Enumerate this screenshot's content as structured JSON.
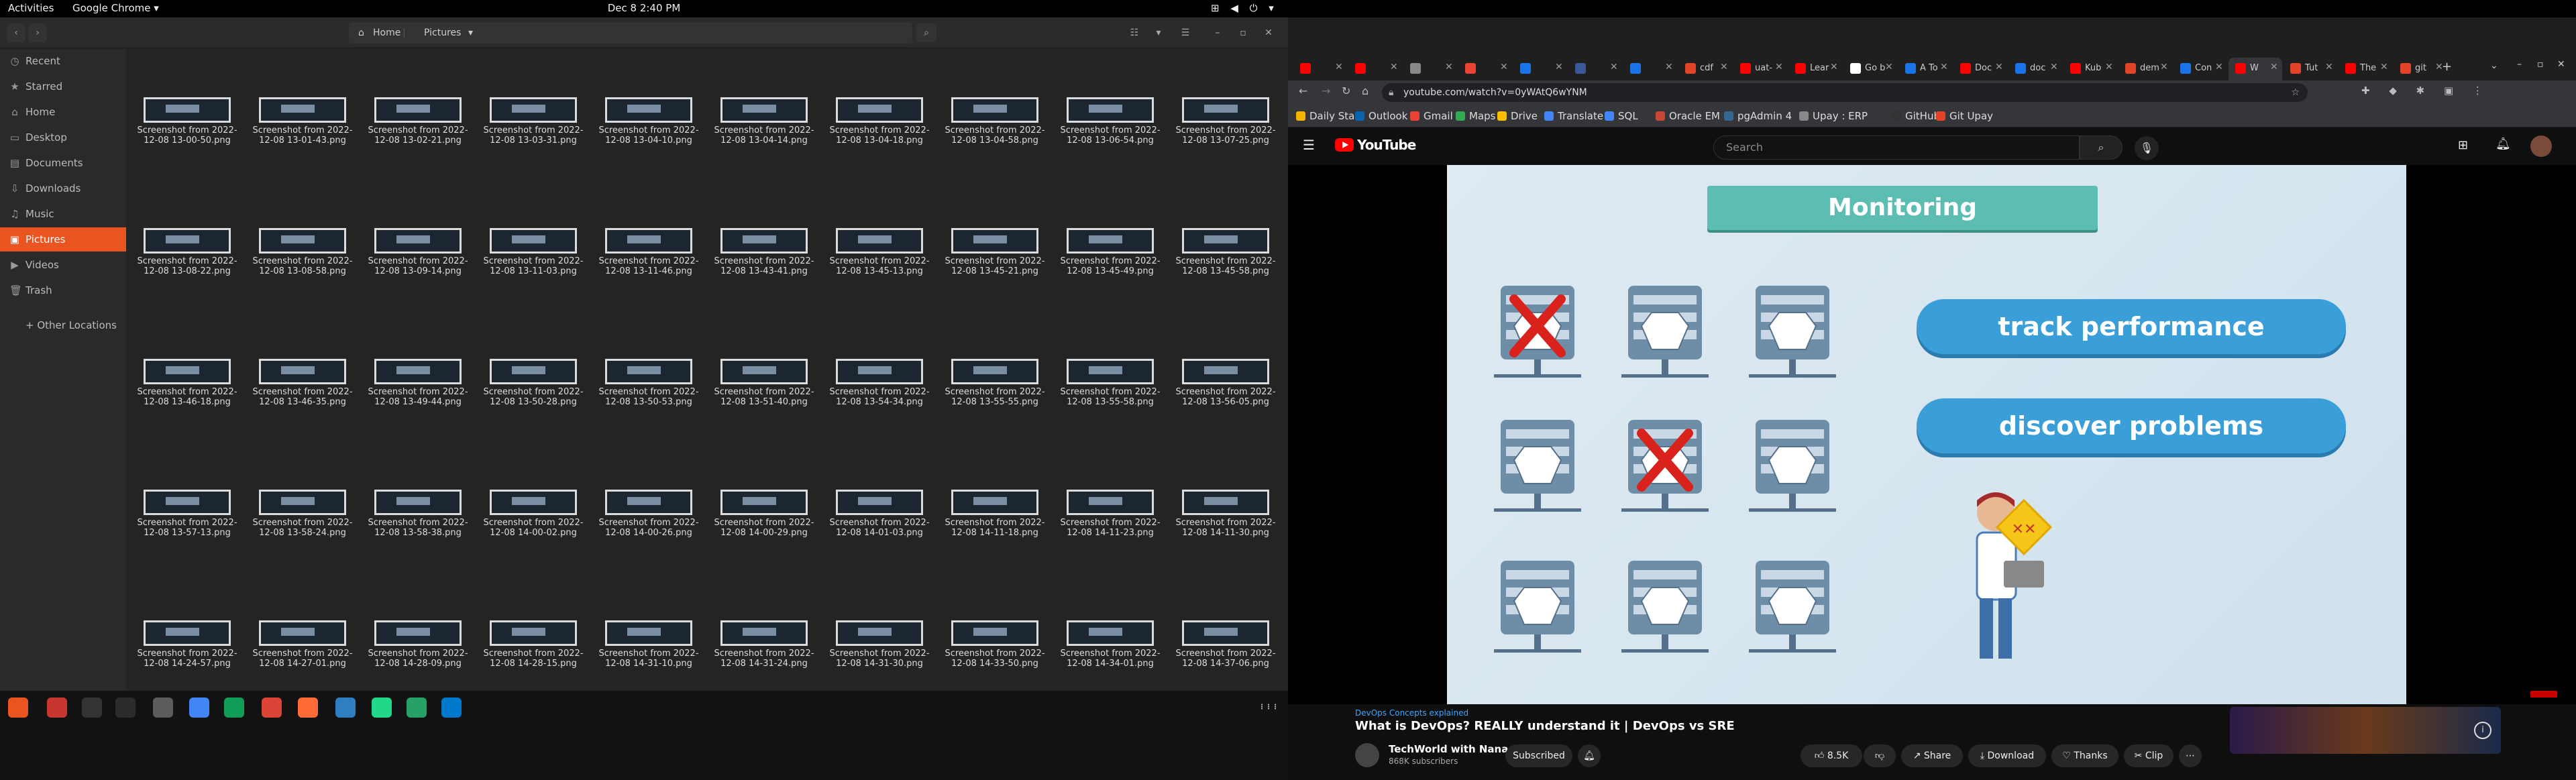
{
  "system": {
    "activities": "Activities",
    "app_menu": "Google Chrome ▾",
    "clock": "Dec 8  2:40 PM",
    "tray": "⊞ ◀ ⏻ ▾"
  },
  "files": {
    "path": {
      "home": "Home",
      "current": "Pictures"
    },
    "sidebar": [
      {
        "label": "Recent",
        "icon": "clock-icon",
        "glyph": "◷"
      },
      {
        "label": "Starred",
        "icon": "star-icon",
        "glyph": "★"
      },
      {
        "label": "Home",
        "icon": "home-icon",
        "glyph": "⌂"
      },
      {
        "label": "Desktop",
        "icon": "desktop-icon",
        "glyph": "▭"
      },
      {
        "label": "Documents",
        "icon": "document-icon",
        "glyph": "▤"
      },
      {
        "label": "Downloads",
        "icon": "download-icon",
        "glyph": "⇩"
      },
      {
        "label": "Music",
        "icon": "music-icon",
        "glyph": "♫"
      },
      {
        "label": "Pictures",
        "icon": "picture-icon",
        "glyph": "▣"
      },
      {
        "label": "Videos",
        "icon": "video-icon",
        "glyph": "▶"
      },
      {
        "label": "Trash",
        "icon": "trash-icon",
        "glyph": "🗑"
      },
      {
        "label": "+ Other Locations",
        "icon": "plus-icon",
        "glyph": ""
      }
    ],
    "active_item": "Pictures",
    "files": [
      "Screenshot from 2022-12-08 13-00-50.png",
      "Screenshot from 2022-12-08 13-01-43.png",
      "Screenshot from 2022-12-08 13-02-21.png",
      "Screenshot from 2022-12-08 13-03-31.png",
      "Screenshot from 2022-12-08 13-04-10.png",
      "Screenshot from 2022-12-08 13-04-14.png",
      "Screenshot from 2022-12-08 13-04-18.png",
      "Screenshot from 2022-12-08 13-04-58.png",
      "Screenshot from 2022-12-08 13-06-54.png",
      "Screenshot from 2022-12-08 13-07-25.png",
      "Screenshot from 2022-12-08 13-08-22.png",
      "Screenshot from 2022-12-08 13-08-58.png",
      "Screenshot from 2022-12-08 13-09-14.png",
      "Screenshot from 2022-12-08 13-11-03.png",
      "Screenshot from 2022-12-08 13-11-46.png",
      "Screenshot from 2022-12-08 13-43-41.png",
      "Screenshot from 2022-12-08 13-45-13.png",
      "Screenshot from 2022-12-08 13-45-21.png",
      "Screenshot from 2022-12-08 13-45-49.png",
      "Screenshot from 2022-12-08 13-45-58.png",
      "Screenshot from 2022-12-08 13-46-18.png",
      "Screenshot from 2022-12-08 13-46-35.png",
      "Screenshot from 2022-12-08 13-49-44.png",
      "Screenshot from 2022-12-08 13-50-28.png",
      "Screenshot from 2022-12-08 13-50-53.png",
      "Screenshot from 2022-12-08 13-51-40.png",
      "Screenshot from 2022-12-08 13-54-34.png",
      "Screenshot from 2022-12-08 13-55-55.png",
      "Screenshot from 2022-12-08 13-55-58.png",
      "Screenshot from 2022-12-08 13-56-05.png",
      "Screenshot from 2022-12-08 13-57-13.png",
      "Screenshot from 2022-12-08 13-58-24.png",
      "Screenshot from 2022-12-08 13-58-38.png",
      "Screenshot from 2022-12-08 14-00-02.png",
      "Screenshot from 2022-12-08 14-00-26.png",
      "Screenshot from 2022-12-08 14-00-29.png",
      "Screenshot from 2022-12-08 14-01-03.png",
      "Screenshot from 2022-12-08 14-11-18.png",
      "Screenshot from 2022-12-08 14-11-23.png",
      "Screenshot from 2022-12-08 14-11-30.png",
      "Screenshot from 2022-12-08 14-24-57.png",
      "Screenshot from 2022-12-08 14-27-01.png",
      "Screenshot from 2022-12-08 14-28-09.png",
      "Screenshot from 2022-12-08 14-28-15.png",
      "Screenshot from 2022-12-08 14-31-10.png",
      "Screenshot from 2022-12-08 14-31-24.png",
      "Screenshot from 2022-12-08 14-31-30.png",
      "Screenshot from 2022-12-08 14-33-50.png",
      "Screenshot from 2022-12-08 14-34-01.png",
      "Screenshot from 2022-12-08 14-37-06.png"
    ]
  },
  "dock": [
    {
      "name": "ubuntu-software-icon",
      "color": "#e95420"
    },
    {
      "name": "app-center-icon",
      "color": "#c7362f"
    },
    {
      "name": "obs-icon",
      "color": "#333333"
    },
    {
      "name": "terminal-icon",
      "color": "#2c2c2c"
    },
    {
      "name": "files-icon",
      "color": "#5c5c5c"
    },
    {
      "name": "docs-icon",
      "color": "#4285f4"
    },
    {
      "name": "sheets-icon",
      "color": "#0f9d58"
    },
    {
      "name": "chrome-icon",
      "color": "#db4437"
    },
    {
      "name": "postman-icon",
      "color": "#ff6c37"
    },
    {
      "name": "virtualbox-icon",
      "color": "#2d7fc1"
    },
    {
      "name": "pycharm-icon",
      "color": "#21d789"
    },
    {
      "name": "image-viewer-icon",
      "color": "#26a269"
    },
    {
      "name": "vscode-icon",
      "color": "#007acc"
    }
  ],
  "chrome": {
    "tabs": [
      {
        "title": "",
        "color": "#ff0000",
        "active": false
      },
      {
        "title": "",
        "color": "#ff0000",
        "active": false
      },
      {
        "title": "",
        "color": "#888888",
        "active": false
      },
      {
        "title": "",
        "color": "#ea4335",
        "active": false
      },
      {
        "title": "",
        "color": "#1a73e8",
        "active": false
      },
      {
        "title": "",
        "color": "#3b5998",
        "active": false
      },
      {
        "title": "",
        "color": "#1a73e8",
        "active": false
      },
      {
        "title": "cdf",
        "color": "#e24329",
        "active": false
      },
      {
        "title": "uat-",
        "color": "#ff0000",
        "active": false
      },
      {
        "title": "Lear",
        "color": "#ff0000",
        "active": false
      },
      {
        "title": "Go b",
        "color": "#ffffff",
        "active": false
      },
      {
        "title": "A To",
        "color": "#1a73e8",
        "active": false
      },
      {
        "title": "Doc",
        "color": "#ff0000",
        "active": false
      },
      {
        "title": "doc",
        "color": "#1a73e8",
        "active": false
      },
      {
        "title": "Kub",
        "color": "#ff0000",
        "active": false
      },
      {
        "title": "dem",
        "color": "#e24329",
        "active": false
      },
      {
        "title": "Con",
        "color": "#1a73e8",
        "active": false
      },
      {
        "title": "W",
        "color": "#ff0000",
        "active": true
      },
      {
        "title": "Tut",
        "color": "#e24329",
        "active": false
      },
      {
        "title": "The",
        "color": "#ff0000",
        "active": false
      },
      {
        "title": "git",
        "color": "#e24329",
        "active": false
      }
    ],
    "url": "youtube.com/watch?v=0yWAtQ6wYNM",
    "bookmarks": [
      {
        "label": "Daily Star",
        "color": "#f5b400"
      },
      {
        "label": "Outlook",
        "color": "#0a64ad"
      },
      {
        "label": "Gmail",
        "color": "#ea4335"
      },
      {
        "label": "Maps",
        "color": "#34a853"
      },
      {
        "label": "Drive",
        "color": "#fbbc04"
      },
      {
        "label": "Translate",
        "color": "#4285f4"
      },
      {
        "label": "SQL",
        "color": "#4285f4"
      },
      {
        "label": "Oracle EM",
        "color": "#c74634"
      },
      {
        "label": "pgAdmin 4",
        "color": "#336791"
      },
      {
        "label": "Upay : ERP",
        "color": "#888888"
      },
      {
        "label": "GitHub",
        "color": "#333333"
      },
      {
        "label": "Git Upay",
        "color": "#e24329"
      }
    ]
  },
  "youtube": {
    "logo_text": "YouTube",
    "search_placeholder": "Search",
    "video": {
      "slide_title": "Monitoring",
      "pill1": "track performance",
      "pill2": "discover problems"
    },
    "series": "DevOps Concepts explained",
    "title": "What is DevOps? REALLY understand it | DevOps vs SRE",
    "channel": "TechWorld with Nana",
    "subscribers": "868K subscribers",
    "subscribed": "Subscribed",
    "likes": "8.5K",
    "share": "Share",
    "download": "Download",
    "thanks": "Thanks",
    "clip": "Clip"
  }
}
